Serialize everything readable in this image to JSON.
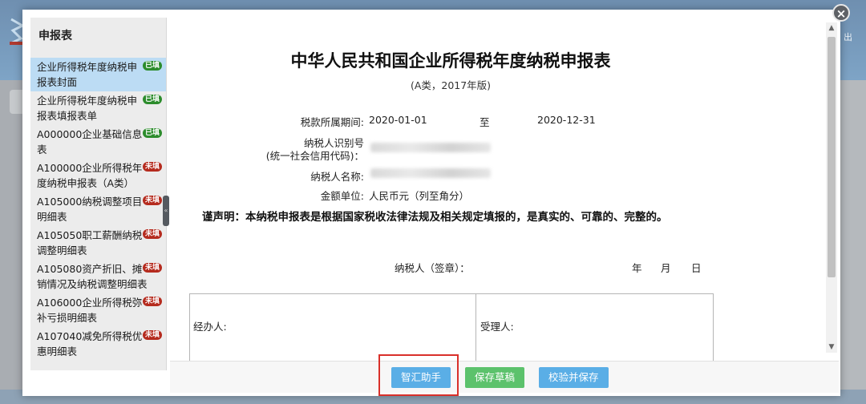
{
  "header": {
    "logout_label": "出"
  },
  "sidebar": {
    "title": "申报表",
    "items": [
      {
        "label": "企业所得税年度纳税申报表封面",
        "status": "已填",
        "active": true
      },
      {
        "label": "企业所得税年度纳税申报表填报表单",
        "status": "已填",
        "active": false
      },
      {
        "label": "A000000企业基础信息表",
        "status": "已填",
        "active": false
      },
      {
        "label": "A100000企业所得税年度纳税申报表（A类）",
        "status": "未填",
        "active": false
      },
      {
        "label": "A105000纳税调整项目明细表",
        "status": "未填",
        "active": false
      },
      {
        "label": "A105050职工薪酬纳税调整明细表",
        "status": "未填",
        "active": false
      },
      {
        "label": "A105080资产折旧、摊销情况及纳税调整明细表",
        "status": "未填",
        "active": false
      },
      {
        "label": "A106000企业所得税弥补亏损明细表",
        "status": "未填",
        "active": false
      },
      {
        "label": "A107040减免所得税优惠明细表",
        "status": "未填",
        "active": false
      }
    ]
  },
  "document": {
    "title": "中华人民共和国企业所得税年度纳税申报表",
    "subtitle": "(A类，2017年版)",
    "period_label": "税款所属期间:",
    "period_start": "2020-01-01",
    "period_to": "至",
    "period_end": "2020-12-31",
    "taxpayer_id_label_1": "纳税人识别号",
    "taxpayer_id_label_2": "(统一社会信用代码)：",
    "taxpayer_name_label": "纳税人名称:",
    "currency_label": "金额单位:",
    "currency_value": "人民币元（列至角分）",
    "declaration": "谨声明：本纳税申报表是根据国家税收法律法规及相关规定填报的，是真实的、可靠的、完整的。",
    "signature_label": "纳税人（签章）：",
    "year_label": "年",
    "month_label": "月",
    "day_label": "日",
    "handler_label": "经办人:",
    "acceptor_label": "受理人:"
  },
  "footer": {
    "assistant_button": "智汇助手",
    "save_draft_button": "保存草稿",
    "validate_save_button": "校验并保存"
  },
  "colors": {
    "accent_blue": "#5aaee6",
    "green": "#5cc26c",
    "done_badge": "#2c8c2c",
    "todo_badge": "#b52b1e",
    "highlight": "#d9302a"
  }
}
